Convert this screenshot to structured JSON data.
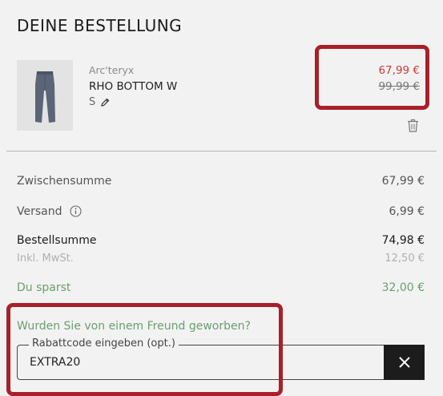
{
  "title": "DEINE BESTELLUNG",
  "item": {
    "brand": "Arc'teryx",
    "name": "RHO BOTTOM W",
    "size": "S",
    "price_new": "67,99 €",
    "price_old": "99,99 €",
    "icons": [
      "pencil-icon",
      "trash-icon",
      "product-image"
    ]
  },
  "summary": {
    "subtotal_label": "Zwischensumme",
    "subtotal_value": "67,99 €",
    "shipping_label": "Versand",
    "shipping_value": "6,99 €",
    "total_label": "Bestellsumme",
    "total_value": "74,98 €",
    "vat_label": "Inkl. MwSt.",
    "vat_value": "12,50 €",
    "savings_label": "Du sparst",
    "savings_value": "32,00 €"
  },
  "referral": {
    "question": "Wurden Sie von einem Freund geworben?",
    "field_label": "Rabattcode eingeben (opt.)",
    "field_value": "EXTRA20"
  },
  "colors": {
    "sale_red": "#c83a3a",
    "savings_green": "#6b9e6f",
    "highlight_box": "#a8202a",
    "button_dark": "#1c1c1c"
  }
}
